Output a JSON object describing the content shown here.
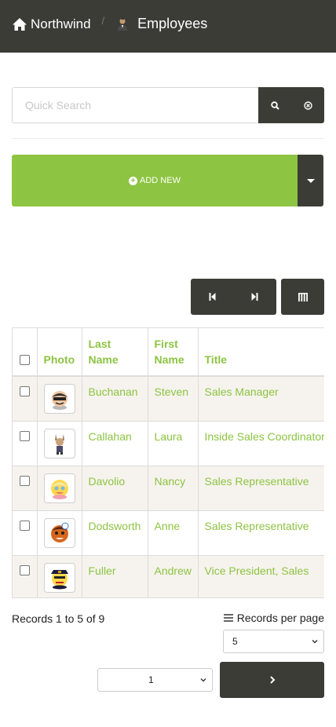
{
  "header": {
    "brand": "Northwind",
    "separator": "/",
    "current_page": "Employees",
    "background_color": "#3c3c37"
  },
  "search": {
    "placeholder": "Quick Search",
    "value": "",
    "search_icon": "search-icon",
    "clear_icon": "clear-circle-icon"
  },
  "toolbar": {
    "add_new_label": "ADD NEW",
    "add_new_icon": "plus-circle-icon",
    "add_new_color": "#8dc442",
    "dropdown_icon": "caret-down-icon"
  },
  "pagination_top": {
    "prev_icon": "skip-back-icon",
    "next_icon": "skip-forward-icon",
    "columns_icon": "columns-icon"
  },
  "table": {
    "headers": {
      "photo": "Photo",
      "last_name": "Last Name",
      "first_name": "First Name",
      "title": "Title"
    },
    "header_color": "#8dc442",
    "rows": [
      {
        "last_name": "Buchanan",
        "first_name": "Steven",
        "title": "Sales Manager",
        "avatar": "emoji-avatar-buchanan"
      },
      {
        "last_name": "Callahan",
        "first_name": "Laura",
        "title": "Inside Sales Coordinator",
        "avatar": "emoji-avatar-callahan"
      },
      {
        "last_name": "Davolio",
        "first_name": "Nancy",
        "title": "Sales Representative",
        "avatar": "emoji-avatar-davolio"
      },
      {
        "last_name": "Dodsworth",
        "first_name": "Anne",
        "title": "Sales Representative",
        "avatar": "emoji-avatar-dodsworth"
      },
      {
        "last_name": "Fuller",
        "first_name": "Andrew",
        "title": "Vice President, Sales",
        "avatar": "emoji-avatar-fuller"
      }
    ]
  },
  "footer": {
    "records_info": "Records 1 to 5 of 9",
    "records_per_page_label": "Records per page",
    "records_per_page_value": "5",
    "page_value": "1",
    "next_icon": "chevron-right-icon"
  }
}
